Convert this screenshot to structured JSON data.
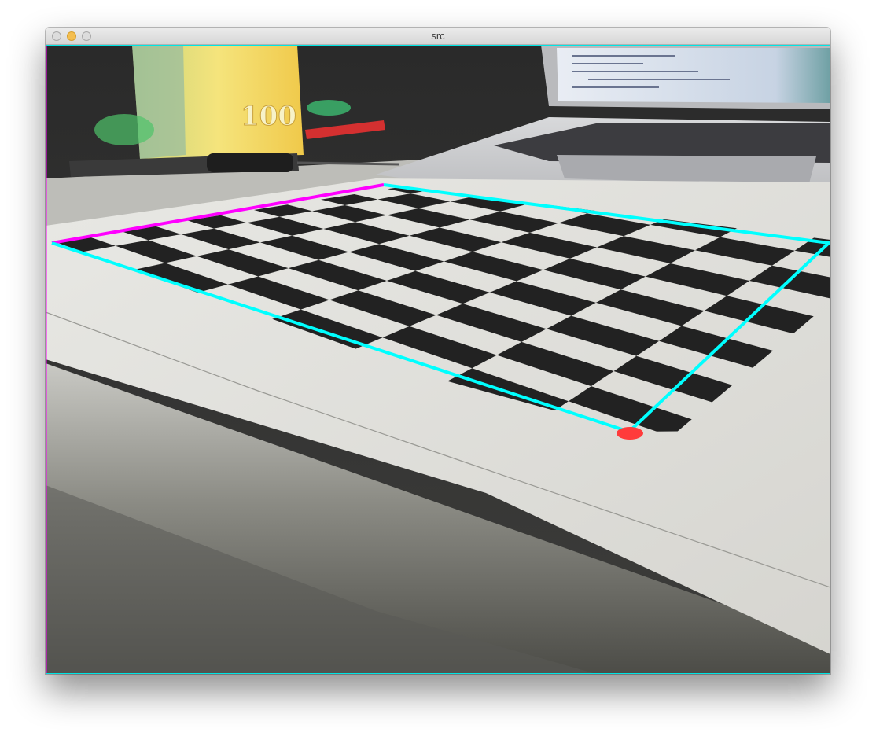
{
  "window": {
    "title": "src",
    "controls": [
      {
        "name": "close-button",
        "icon": "close-dot-icon",
        "color": "#dcdcdc"
      },
      {
        "name": "minimize-button",
        "icon": "minimize-dot-icon",
        "color": "#f4be4f"
      },
      {
        "name": "zoom-button",
        "icon": "zoom-dot-icon",
        "color": "#dcdcdc"
      }
    ]
  },
  "image_view": {
    "description_icons": [
      "checkerboard",
      "juice-carton",
      "laptop",
      "pen"
    ],
    "overlay_colors": {
      "quad_outline": "#00ffff",
      "top_left_edge": "#ff00ff",
      "corner_point": "#ff3b3b"
    },
    "carton_label": "100"
  }
}
